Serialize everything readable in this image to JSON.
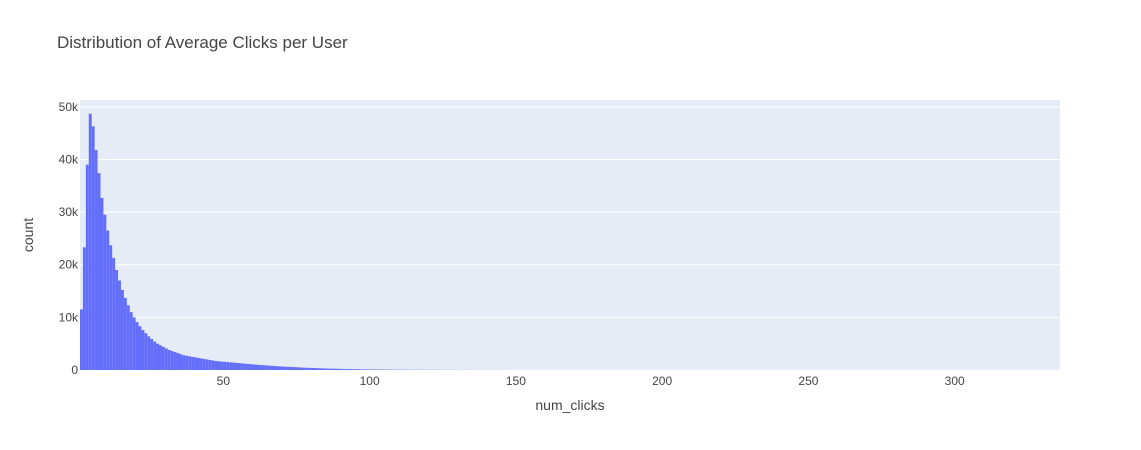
{
  "chart_data": {
    "type": "bar",
    "title": "Distribution of Average Clicks per User",
    "xlabel": "num_clicks",
    "ylabel": "count",
    "xlim": [
      1,
      336
    ],
    "ylim": [
      0,
      51300
    ],
    "x_ticks": [
      50,
      100,
      150,
      200,
      250,
      300
    ],
    "y_ticks": [
      0,
      10000,
      20000,
      30000,
      40000,
      50000
    ],
    "y_tick_labels": [
      "0",
      "10k",
      "20k",
      "30k",
      "40k",
      "50k"
    ],
    "grid": true,
    "bin_width": 1,
    "series": [
      {
        "x": [
          1,
          2,
          3,
          4,
          5,
          6,
          7,
          8,
          9,
          10,
          11,
          12,
          13,
          14,
          15,
          16,
          17,
          18,
          19,
          20,
          21,
          22,
          23,
          24,
          25,
          26,
          27,
          28,
          29,
          30,
          31,
          32,
          33,
          34,
          35,
          36,
          37,
          38,
          39,
          40,
          41,
          42,
          43,
          44,
          45,
          46,
          47,
          48,
          49,
          50,
          51,
          52,
          53,
          54,
          55,
          56,
          57,
          58,
          59,
          60,
          61,
          62,
          63,
          64,
          65,
          66,
          67,
          68,
          69,
          70,
          71,
          72,
          73,
          74,
          75,
          76,
          77,
          78,
          79,
          80,
          81,
          82,
          83,
          84,
          85,
          86,
          87,
          88,
          89,
          90,
          91,
          92,
          93,
          94,
          95,
          96,
          97,
          98,
          99,
          100,
          101,
          102,
          103,
          104,
          105,
          106,
          107,
          108,
          109,
          110,
          111,
          112,
          113,
          114,
          115,
          116,
          117,
          118,
          119,
          120,
          121,
          122,
          123,
          124,
          125,
          126,
          127,
          128,
          129,
          130,
          131,
          132,
          133,
          134,
          135,
          136,
          137,
          138,
          139,
          140,
          141,
          142,
          143,
          144,
          145,
          146
        ],
        "values": [
          11500,
          23300,
          39000,
          48700,
          46300,
          41800,
          37400,
          32700,
          29500,
          26500,
          23700,
          21300,
          19000,
          17000,
          15200,
          13700,
          12300,
          11000,
          10000,
          9100,
          8300,
          7600,
          7000,
          6400,
          5900,
          5400,
          5000,
          4700,
          4400,
          4100,
          3800,
          3600,
          3400,
          3200,
          3000,
          2800,
          2700,
          2600,
          2500,
          2400,
          2300,
          2200,
          2100,
          2000,
          1900,
          1800,
          1700,
          1650,
          1600,
          1550,
          1500,
          1450,
          1400,
          1350,
          1300,
          1250,
          1200,
          1150,
          1100,
          1050,
          1000,
          960,
          920,
          880,
          840,
          800,
          760,
          720,
          690,
          660,
          630,
          600,
          570,
          540,
          510,
          480,
          455,
          430,
          405,
          380,
          360,
          340,
          320,
          300,
          280,
          265,
          250,
          235,
          220,
          205,
          190,
          180,
          170,
          160,
          150,
          140,
          130,
          122,
          115,
          108,
          101,
          95,
          89,
          83,
          78,
          73,
          68,
          64,
          60,
          56,
          52,
          49,
          46,
          43,
          40,
          37,
          35,
          33,
          31,
          29,
          27,
          25,
          23,
          21,
          20,
          19,
          18,
          17,
          16,
          15,
          14,
          13,
          12,
          11,
          10,
          9,
          9,
          8,
          8,
          7,
          7,
          6,
          6,
          5,
          5,
          4
        ]
      }
    ],
    "colors": {
      "bar": "#636efa",
      "plot_bg": "#e5ecf6",
      "grid": "#ffffff",
      "text": "#444444"
    }
  }
}
